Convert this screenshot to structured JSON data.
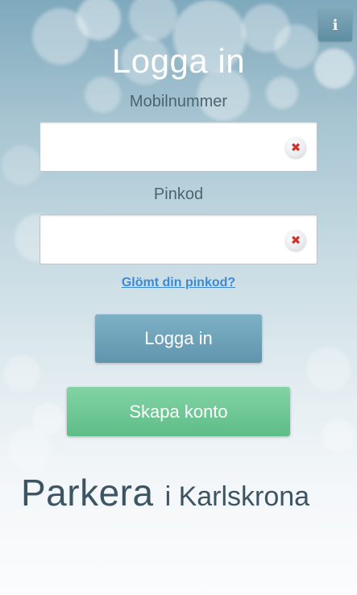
{
  "header": {
    "title": "Logga in",
    "info_label": "i"
  },
  "form": {
    "mobile": {
      "label": "Mobilnummer",
      "value": "",
      "placeholder": ""
    },
    "pin": {
      "label": "Pinkod",
      "value": "",
      "placeholder": ""
    },
    "clear_icon": "✖",
    "forgot_link": "Glömt din pinkod?",
    "login_button": "Logga in",
    "create_button": "Skapa konto"
  },
  "branding": {
    "main": "Parkera",
    "sub": "i Karlskrona"
  },
  "colors": {
    "login_button": "#6ea3ba",
    "create_button": "#6fc895",
    "link": "#3b8ad6",
    "clear_x": "#d0342c"
  },
  "icons": {
    "info": "info-icon",
    "clear": "clear-icon"
  }
}
